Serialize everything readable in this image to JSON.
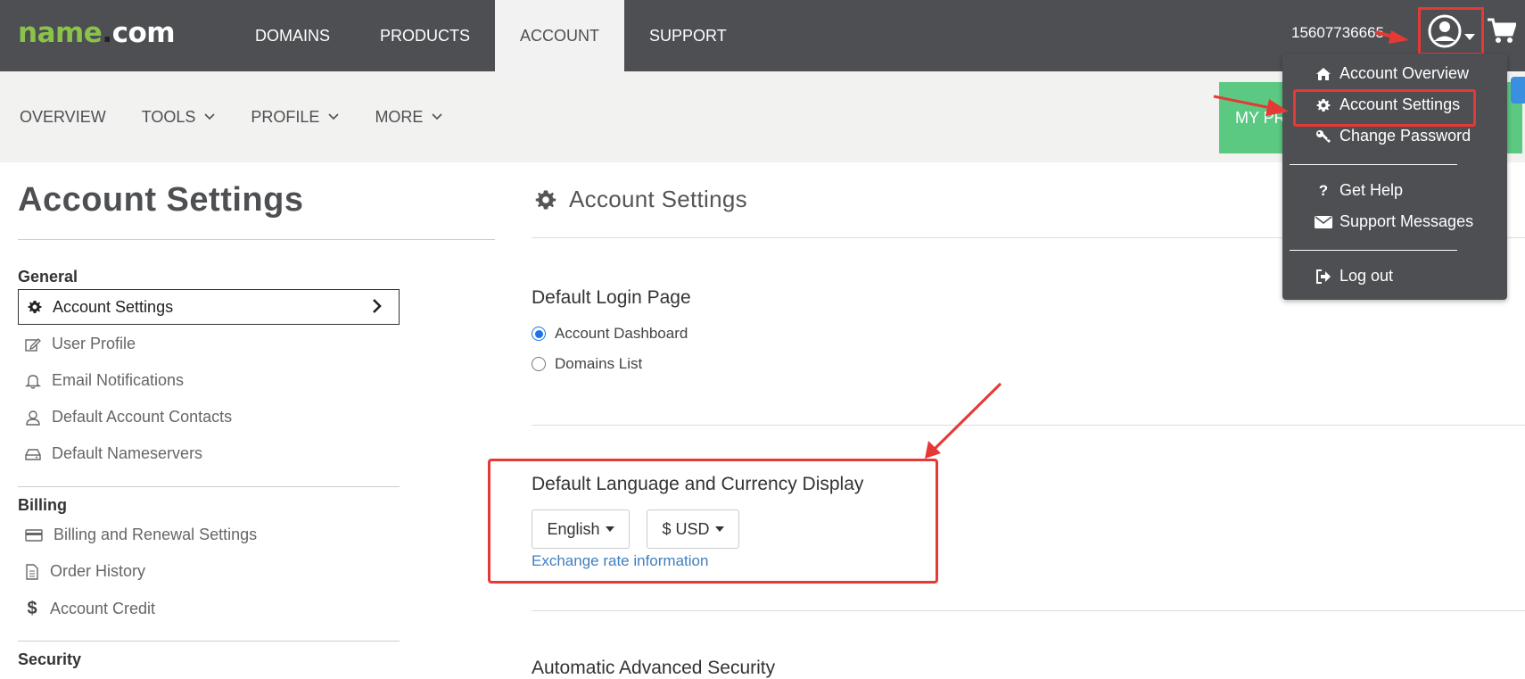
{
  "header": {
    "logo": {
      "part1": "name",
      "dot": ".",
      "part2": "com"
    },
    "nav": [
      "DOMAINS",
      "PRODUCTS",
      "ACCOUNT",
      "SUPPORT"
    ],
    "active_nav": "ACCOUNT",
    "account_id": "15607736665",
    "icons": {
      "user": "user-circle-icon",
      "caret": "caret-down-icon",
      "cart": "cart-icon"
    }
  },
  "subnav": {
    "items": [
      "OVERVIEW",
      "TOOLS",
      "PROFILE",
      "MORE"
    ],
    "button_label": "MY PR"
  },
  "sidebar": {
    "title": "Account Settings",
    "general": {
      "heading": "General",
      "items": [
        {
          "label": "Account Settings",
          "icon": "gear-icon",
          "active": true
        },
        {
          "label": "User Profile",
          "icon": "edit-icon"
        },
        {
          "label": "Email Notifications",
          "icon": "bell-icon"
        },
        {
          "label": "Default Account Contacts",
          "icon": "user-icon"
        },
        {
          "label": "Default Nameservers",
          "icon": "server-icon"
        }
      ]
    },
    "billing": {
      "heading": "Billing",
      "items": [
        {
          "label": "Billing and Renewal Settings",
          "icon": "credit-card-icon"
        },
        {
          "label": "Order History",
          "icon": "document-icon"
        },
        {
          "label": "Account Credit",
          "icon": "dollar-icon"
        }
      ]
    },
    "security": {
      "heading": "Security"
    }
  },
  "main": {
    "title": "Account Settings",
    "login": {
      "heading": "Default Login Page",
      "options": [
        "Account Dashboard",
        "Domains List"
      ],
      "selected": "Account Dashboard"
    },
    "language": {
      "heading": "Default Language and Currency Display",
      "language": "English",
      "currency": "$ USD",
      "exchange_link": "Exchange rate information"
    },
    "next_heading": "Automatic Advanced Security"
  },
  "dropdown": {
    "items": [
      {
        "label": "Account Overview",
        "icon": "home-icon"
      },
      {
        "label": "Account Settings",
        "icon": "gear-icon"
      },
      {
        "label": "Change Password",
        "icon": "key-icon"
      },
      {
        "label": "Get Help",
        "icon": "question-icon"
      },
      {
        "label": "Support Messages",
        "icon": "envelope-icon"
      },
      {
        "label": "Log out",
        "icon": "logout-icon"
      }
    ]
  },
  "colors": {
    "topbar": "#4d4f53",
    "brand_green": "#8bc34a",
    "highlight": "#e53935",
    "link": "#3f7fbf",
    "cta_green": "#5bc982"
  }
}
